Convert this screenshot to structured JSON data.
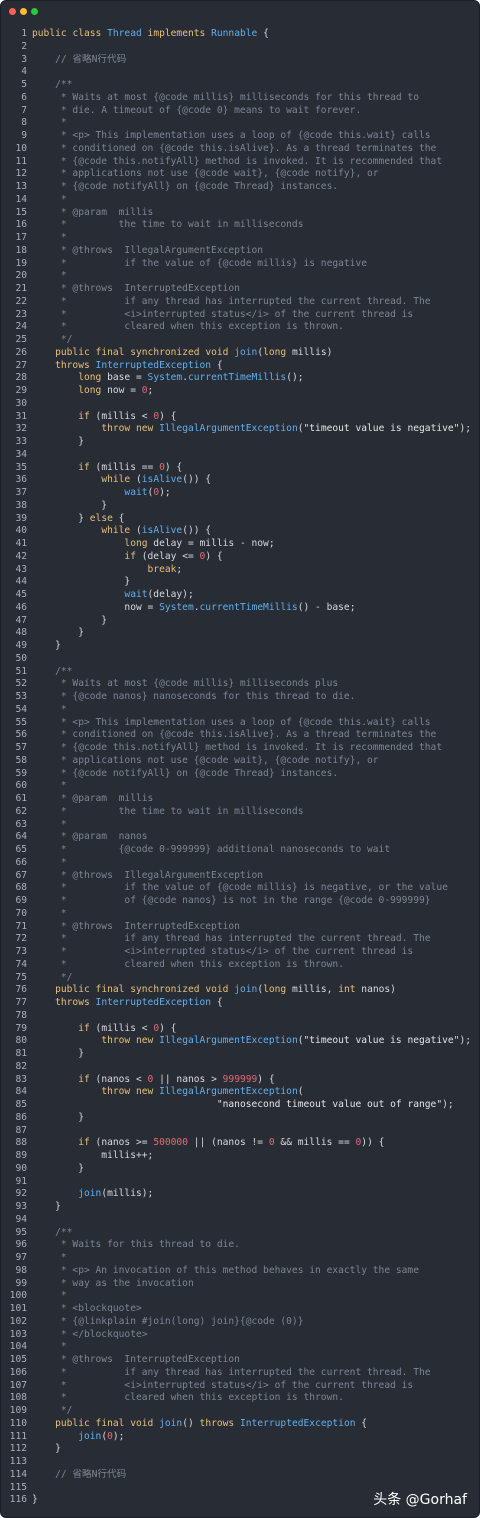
{
  "window": {
    "controls": {
      "close": "close",
      "minimize": "minimize",
      "zoom": "zoom"
    },
    "colors": {
      "close": "#ff5f57",
      "minimize": "#febc2e",
      "zoom": "#28c840",
      "background": "#282c34"
    }
  },
  "code": [
    {
      "n": "1",
      "t": "public class Thread implements Runnable {"
    },
    {
      "n": "2",
      "t": ""
    },
    {
      "n": "3",
      "t": "    // 省略N行代码"
    },
    {
      "n": "4",
      "t": ""
    },
    {
      "n": "5",
      "t": "    /**"
    },
    {
      "n": "6",
      "t": "     * Waits at most {@code millis} milliseconds for this thread to"
    },
    {
      "n": "7",
      "t": "     * die. A timeout of {@code 0} means to wait forever."
    },
    {
      "n": "8",
      "t": "     *"
    },
    {
      "n": "9",
      "t": "     * <p> This implementation uses a loop of {@code this.wait} calls"
    },
    {
      "n": "10",
      "t": "     * conditioned on {@code this.isAlive}. As a thread terminates the"
    },
    {
      "n": "11",
      "t": "     * {@code this.notifyAll} method is invoked. It is recommended that"
    },
    {
      "n": "12",
      "t": "     * applications not use {@code wait}, {@code notify}, or"
    },
    {
      "n": "13",
      "t": "     * {@code notifyAll} on {@code Thread} instances."
    },
    {
      "n": "14",
      "t": "     *"
    },
    {
      "n": "15",
      "t": "     * @param  millis"
    },
    {
      "n": "16",
      "t": "     *         the time to wait in milliseconds"
    },
    {
      "n": "17",
      "t": "     *"
    },
    {
      "n": "18",
      "t": "     * @throws  IllegalArgumentException"
    },
    {
      "n": "19",
      "t": "     *          if the value of {@code millis} is negative"
    },
    {
      "n": "20",
      "t": "     *"
    },
    {
      "n": "21",
      "t": "     * @throws  InterruptedException"
    },
    {
      "n": "22",
      "t": "     *          if any thread has interrupted the current thread. The"
    },
    {
      "n": "23",
      "t": "     *          <i>interrupted status</i> of the current thread is"
    },
    {
      "n": "24",
      "t": "     *          cleared when this exception is thrown."
    },
    {
      "n": "25",
      "t": "     */"
    },
    {
      "n": "26",
      "t": "    public final synchronized void join(long millis)"
    },
    {
      "n": "27",
      "t": "    throws InterruptedException {"
    },
    {
      "n": "28",
      "t": "        long base = System.currentTimeMillis();"
    },
    {
      "n": "29",
      "t": "        long now = 0;"
    },
    {
      "n": "30",
      "t": ""
    },
    {
      "n": "31",
      "t": "        if (millis < 0) {"
    },
    {
      "n": "32",
      "t": "            throw new IllegalArgumentException(\"timeout value is negative\");"
    },
    {
      "n": "33",
      "t": "        }"
    },
    {
      "n": "34",
      "t": ""
    },
    {
      "n": "35",
      "t": "        if (millis == 0) {"
    },
    {
      "n": "36",
      "t": "            while (isAlive()) {"
    },
    {
      "n": "37",
      "t": "                wait(0);"
    },
    {
      "n": "38",
      "t": "            }"
    },
    {
      "n": "39",
      "t": "        } else {"
    },
    {
      "n": "40",
      "t": "            while (isAlive()) {"
    },
    {
      "n": "41",
      "t": "                long delay = millis - now;"
    },
    {
      "n": "42",
      "t": "                if (delay <= 0) {"
    },
    {
      "n": "43",
      "t": "                    break;"
    },
    {
      "n": "44",
      "t": "                }"
    },
    {
      "n": "45",
      "t": "                wait(delay);"
    },
    {
      "n": "46",
      "t": "                now = System.currentTimeMillis() - base;"
    },
    {
      "n": "47",
      "t": "            }"
    },
    {
      "n": "48",
      "t": "        }"
    },
    {
      "n": "49",
      "t": "    }"
    },
    {
      "n": "50",
      "t": ""
    },
    {
      "n": "51",
      "t": "    /**"
    },
    {
      "n": "52",
      "t": "     * Waits at most {@code millis} milliseconds plus"
    },
    {
      "n": "53",
      "t": "     * {@code nanos} nanoseconds for this thread to die."
    },
    {
      "n": "54",
      "t": "     *"
    },
    {
      "n": "55",
      "t": "     * <p> This implementation uses a loop of {@code this.wait} calls"
    },
    {
      "n": "56",
      "t": "     * conditioned on {@code this.isAlive}. As a thread terminates the"
    },
    {
      "n": "57",
      "t": "     * {@code this.notifyAll} method is invoked. It is recommended that"
    },
    {
      "n": "58",
      "t": "     * applications not use {@code wait}, {@code notify}, or"
    },
    {
      "n": "59",
      "t": "     * {@code notifyAll} on {@code Thread} instances."
    },
    {
      "n": "60",
      "t": "     *"
    },
    {
      "n": "61",
      "t": "     * @param  millis"
    },
    {
      "n": "62",
      "t": "     *         the time to wait in milliseconds"
    },
    {
      "n": "63",
      "t": "     *"
    },
    {
      "n": "64",
      "t": "     * @param  nanos"
    },
    {
      "n": "65",
      "t": "     *         {@code 0-999999} additional nanoseconds to wait"
    },
    {
      "n": "66",
      "t": "     *"
    },
    {
      "n": "67",
      "t": "     * @throws  IllegalArgumentException"
    },
    {
      "n": "68",
      "t": "     *          if the value of {@code millis} is negative, or the value"
    },
    {
      "n": "69",
      "t": "     *          of {@code nanos} is not in the range {@code 0-999999}"
    },
    {
      "n": "70",
      "t": "     *"
    },
    {
      "n": "71",
      "t": "     * @throws  InterruptedException"
    },
    {
      "n": "72",
      "t": "     *          if any thread has interrupted the current thread. The"
    },
    {
      "n": "73",
      "t": "     *          <i>interrupted status</i> of the current thread is"
    },
    {
      "n": "74",
      "t": "     *          cleared when this exception is thrown."
    },
    {
      "n": "75",
      "t": "     */"
    },
    {
      "n": "76",
      "t": "    public final synchronized void join(long millis, int nanos)"
    },
    {
      "n": "77",
      "t": "    throws InterruptedException {"
    },
    {
      "n": "78",
      "t": ""
    },
    {
      "n": "79",
      "t": "        if (millis < 0) {"
    },
    {
      "n": "80",
      "t": "            throw new IllegalArgumentException(\"timeout value is negative\");"
    },
    {
      "n": "81",
      "t": "        }"
    },
    {
      "n": "82",
      "t": ""
    },
    {
      "n": "83",
      "t": "        if (nanos < 0 || nanos > 999999) {"
    },
    {
      "n": "84",
      "t": "            throw new IllegalArgumentException("
    },
    {
      "n": "85",
      "t": "                                \"nanosecond timeout value out of range\");"
    },
    {
      "n": "86",
      "t": "        }"
    },
    {
      "n": "87",
      "t": ""
    },
    {
      "n": "88",
      "t": "        if (nanos >= 500000 || (nanos != 0 && millis == 0)) {"
    },
    {
      "n": "89",
      "t": "            millis++;"
    },
    {
      "n": "90",
      "t": "        }"
    },
    {
      "n": "91",
      "t": ""
    },
    {
      "n": "92",
      "t": "        join(millis);"
    },
    {
      "n": "93",
      "t": "    }"
    },
    {
      "n": "94",
      "t": ""
    },
    {
      "n": "95",
      "t": "    /**"
    },
    {
      "n": "96",
      "t": "     * Waits for this thread to die."
    },
    {
      "n": "97",
      "t": "     *"
    },
    {
      "n": "98",
      "t": "     * <p> An invocation of this method behaves in exactly the same"
    },
    {
      "n": "99",
      "t": "     * way as the invocation"
    },
    {
      "n": "100",
      "t": "     *"
    },
    {
      "n": "101",
      "t": "     * <blockquote>"
    },
    {
      "n": "102",
      "t": "     * {@linkplain #join(long) join}{@code (0)}"
    },
    {
      "n": "103",
      "t": "     * </blockquote>"
    },
    {
      "n": "104",
      "t": "     *"
    },
    {
      "n": "105",
      "t": "     * @throws  InterruptedException"
    },
    {
      "n": "106",
      "t": "     *          if any thread has interrupted the current thread. The"
    },
    {
      "n": "107",
      "t": "     *          <i>interrupted status</i> of the current thread is"
    },
    {
      "n": "108",
      "t": "     *          cleared when this exception is thrown."
    },
    {
      "n": "109",
      "t": "     */"
    },
    {
      "n": "110",
      "t": "    public final void join() throws InterruptedException {"
    },
    {
      "n": "111",
      "t": "        join(0);"
    },
    {
      "n": "112",
      "t": "    }"
    },
    {
      "n": "113",
      "t": ""
    },
    {
      "n": "114",
      "t": "    // 省略N行代码"
    },
    {
      "n": "115",
      "t": ""
    },
    {
      "n": "116",
      "t": "}"
    }
  ],
  "watermark": "头条 @Gorhaf"
}
